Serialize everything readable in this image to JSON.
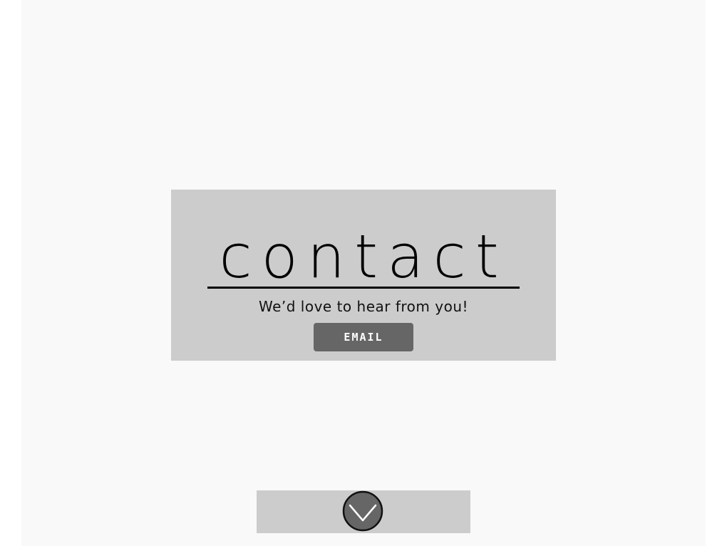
{
  "contact": {
    "title": "contact",
    "tagline": "We’d love to hear from you!",
    "email_button_label": "EMAIL"
  },
  "scroll": {
    "icon": "chevron-down-circle-icon"
  },
  "colors": {
    "page_background": "#f9f9f9",
    "card_background": "#cccccc",
    "button_background": "#666666",
    "button_text": "#ffffff"
  }
}
